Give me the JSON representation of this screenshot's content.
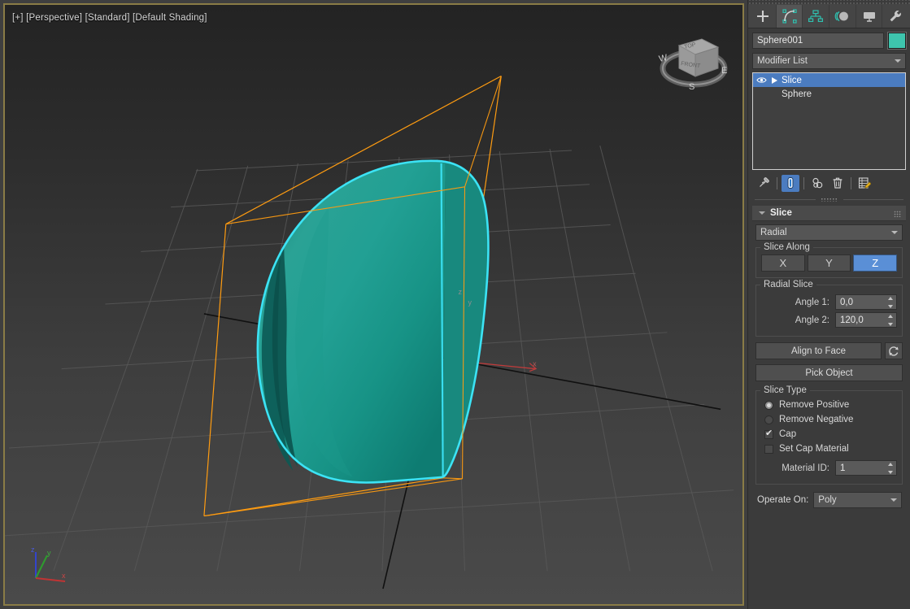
{
  "viewport": {
    "label": "[+] [Perspective] [Standard] [Default Shading]",
    "label_parts": [
      "[+]",
      "[Perspective]",
      "[Standard]",
      "[Default Shading]"
    ],
    "border_color": "#8a7c46",
    "object_color": "#19998c",
    "selection_outline_color": "#3ce3f5",
    "gizmo_color": "#ff9c11",
    "grid_color": "#555555",
    "axis_x_color": "#cc3333",
    "axis_y_color": "#33aa33",
    "axis_z_color": "#3344cc",
    "viewcube": {
      "top_face": "TOP",
      "front_face": "FRONT",
      "compass": [
        "W",
        "E",
        "S"
      ]
    },
    "tripod": {
      "x": "x",
      "y": "y",
      "z": "z"
    },
    "axis_tripod_label_x": "x"
  },
  "panel": {
    "tabs": [
      {
        "name": "create",
        "icon": "plus-icon",
        "active": false
      },
      {
        "name": "modify",
        "icon": "modify-icon",
        "active": true
      },
      {
        "name": "hierarchy",
        "icon": "hierarchy-icon",
        "active": false
      },
      {
        "name": "motion",
        "icon": "motion-icon",
        "active": false
      },
      {
        "name": "display",
        "icon": "display-icon",
        "active": false
      },
      {
        "name": "utilities",
        "icon": "wrench-icon",
        "active": false
      }
    ],
    "object_name": "Sphere001",
    "object_color_swatch": "#3ec4ad",
    "modifier_list_label": "Modifier List",
    "modifier_stack": [
      {
        "label": "Slice",
        "selected": true,
        "has_eye": true,
        "has_arrow": true
      },
      {
        "label": "Sphere",
        "selected": false,
        "has_eye": false,
        "has_arrow": false
      }
    ],
    "stack_tools": [
      {
        "name": "pin-stack-icon",
        "active": false
      },
      {
        "name": "show-end-result-icon",
        "active": true
      },
      {
        "name": "make-unique-icon",
        "active": false
      },
      {
        "name": "remove-modifier-icon",
        "active": false
      },
      {
        "name": "configure-modifier-sets-icon",
        "active": false
      }
    ]
  },
  "slice": {
    "rollout_title": "Slice",
    "slice_mode": "Radial",
    "slice_along": {
      "group_label": "Slice Along",
      "options": [
        "X",
        "Y",
        "Z"
      ],
      "selected": "Z"
    },
    "radial_slice": {
      "group_label": "Radial Slice",
      "angle1_label": "Angle 1:",
      "angle1_value": "0,0",
      "angle2_label": "Angle 2:",
      "angle2_value": "120,0"
    },
    "align_to_face_label": "Align to Face",
    "reset_icon": "reset-icon",
    "pick_object_label": "Pick Object",
    "slice_type": {
      "group_label": "Slice Type",
      "options": [
        {
          "label": "Remove Positive",
          "type": "radio",
          "checked": true
        },
        {
          "label": "Remove Negative",
          "type": "radio",
          "checked": false
        },
        {
          "label": "Cap",
          "type": "checkbox",
          "checked": true
        },
        {
          "label": "Set Cap Material",
          "type": "checkbox",
          "checked": false
        }
      ],
      "material_id_label": "Material  ID:",
      "material_id_value": "1"
    },
    "operate_on_label": "Operate On:",
    "operate_on_value": "Poly"
  }
}
